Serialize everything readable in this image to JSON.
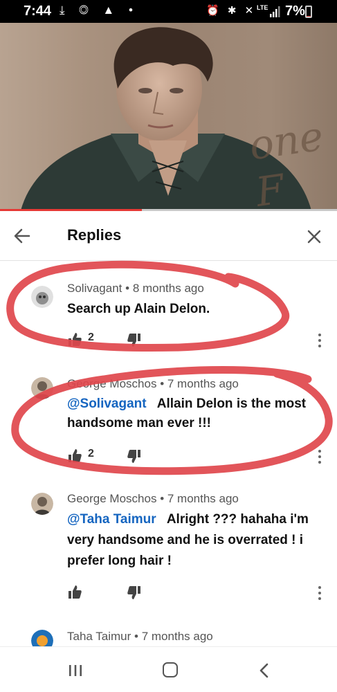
{
  "status_bar": {
    "time": "7:44",
    "left_icons": "⤓ ◎ ▲ •",
    "right_icons": "⏰ ✱ ✕",
    "network": "LTE",
    "battery": "7%",
    "battery_level": 0.07,
    "battery_color": "#e53935"
  },
  "video": {
    "background_text": "one F",
    "progress_fraction": 0.42,
    "progress_color": "#e53935"
  },
  "header": {
    "title": "Replies",
    "back_icon": "arrow-left-icon",
    "close_icon": "close-icon"
  },
  "comments": [
    {
      "author": "Solivagant",
      "time": "8 months ago",
      "mention": "",
      "text": "Search up Alain Delon.",
      "likes": "2",
      "avatar_colors": [
        "#bdbdbd",
        "#e0e0e0"
      ]
    },
    {
      "author": "George Moschos",
      "time": "7 months ago",
      "mention": "@Solivagant",
      "text": "Allain Delon is the most handsome man ever !!!",
      "likes": "2",
      "avatar_colors": [
        "#6d5f52",
        "#c8b7a4"
      ]
    },
    {
      "author": "George Moschos",
      "time": "7 months ago",
      "mention": "@Taha Taimur",
      "text": "Alright ??? hahaha  i'm very handsome and he is overrated !  i prefer long hair !",
      "likes": "",
      "avatar_colors": [
        "#6d5f52",
        "#c8b7a4"
      ]
    },
    {
      "author": "Taha Taimur",
      "time": "7 months ago",
      "mention": "",
      "text": "",
      "likes": "",
      "avatar_colors": [
        "#1e6fb8",
        "#f0a030"
      ]
    }
  ],
  "meta_separator": "•",
  "annotation_color": "#e0474c",
  "link_color": "#1565c0"
}
